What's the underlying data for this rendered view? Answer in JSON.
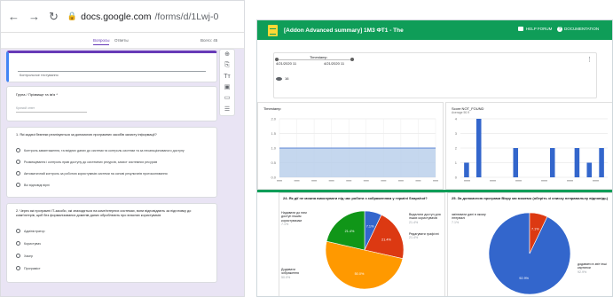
{
  "browser": {
    "url_host": "docs.google.com",
    "url_path": "/forms/d/1Lwj-0UyvBC/9HOxdPY"
  },
  "form": {
    "tabs": [
      "Вопросы",
      "Ответы",
      "Всего: 45"
    ],
    "header_text": "Контрольное тестування",
    "q1": {
      "title": "Група / Прізвище та ім'я *",
      "hint": "Краткий ответ"
    },
    "q2": {
      "text": "1. Які задачі безпеки реалізуються за допомогою програмних засобів захисту інформації?",
      "options": [
        "Контроль завантаження, та вхідних даних до системи та контроль системи та за несанкціонованого доступу",
        "Розмежування і контроль прав доступу до системних ресурсів, захист системних ресурсів",
        "Автоматичний контроль за роботою користувачів системи на основі результатів протоколювання",
        "Всі відповіді вірні"
      ]
    },
    "q3": {
      "text": "2. Через які програмні IT-засоби, які знаходяться на комп'ютерних системах, вони відповідають за підготовку до комп'ютерів, щоб без формалізованих доменів даних оброблюють про власних користувачів",
      "options": [
        "Адміністратор",
        "Користувач",
        "Хакер",
        "Програміст"
      ]
    },
    "toolbar_icons": [
      "add-question-icon",
      "import-icon",
      "title-text-icon",
      "image-icon",
      "video-icon",
      "section-icon"
    ]
  },
  "sheet": {
    "title": "[Addon Advanced summary] 1М3 ФТ1 - The",
    "help_label": "HELP FORUM",
    "doc_label": "DOCUMENTATION",
    "timestamp_label": "Timestamp",
    "range_start": "4/21/2020 11",
    "range_end": "4/21/2020 11",
    "count": "16",
    "colors": {
      "bar": "#3366cc",
      "area": "#b6cdea",
      "brand": "#0f9d58",
      "blue": "#3366cc",
      "red": "#dc3912",
      "orange": "#ff9900",
      "green": "#109618"
    }
  },
  "chart_data": [
    {
      "type": "area",
      "title": "Timestamp",
      "subtitle": "",
      "y_ticks": [
        "2.0",
        "1.5",
        "1.0",
        "0.5",
        "0.0"
      ],
      "x_tick_count": 10,
      "values": [
        1,
        1,
        1,
        1,
        1,
        1,
        1,
        1,
        1,
        1
      ],
      "ylim": [
        0,
        2
      ]
    },
    {
      "type": "bar",
      "title": "Score NOT_FOUND",
      "subtitle": "Average 50.9",
      "y_ticks": [
        "4",
        "3",
        "2",
        "1",
        "0"
      ],
      "values": [
        1,
        4,
        0,
        0,
        2,
        0,
        0,
        2,
        0,
        2,
        1,
        2
      ],
      "ylim": [
        0,
        4
      ]
    },
    {
      "type": "pie",
      "title": "24. Як дії не можна виконувати під час роботи з зображенням у терміні Snapshot?",
      "slices": [
        {
          "label": "Надавати до ним доступ іншим користувачам",
          "value": 7.1,
          "pct": "7.1%"
        },
        {
          "label": "Видаляти доступ для інших користувачів",
          "value": 21.4,
          "pct": "21.4%"
        },
        {
          "label": "Додавати зображення",
          "value": 50.0,
          "pct": "50.0%"
        },
        {
          "label": "Редагувати графічні",
          "value": 21.4,
          "pct": "21.4%"
        }
      ]
    },
    {
      "type": "pie",
      "title": "25. За допомогою програми Вікру ми можемо (оберіть зі списку неправильну відповідь)",
      "slices": [
        {
          "label": "додавати в звіт інші картинки",
          "value": 92.9,
          "pct": "92.9%"
        },
        {
          "label": "змінювати дані в якому інтервалі",
          "value": 7.1,
          "pct": "7.1%"
        }
      ]
    }
  ]
}
